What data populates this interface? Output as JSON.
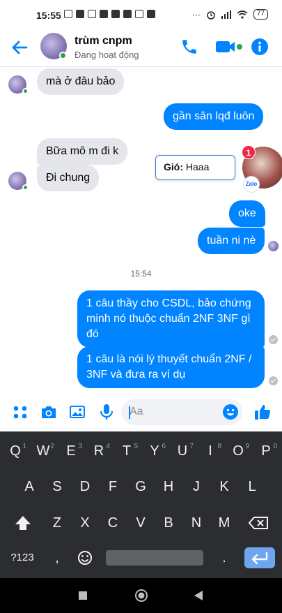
{
  "status_bar": {
    "time": "15:55",
    "battery": "77"
  },
  "header": {
    "contact_name": "trùm cnpm",
    "contact_status": "Đang hoạt động"
  },
  "messages": [
    {
      "direction": "in",
      "text": "mà ở đâu bảo"
    },
    {
      "direction": "out",
      "text": "gần sân lqđ luôn"
    },
    {
      "direction": "in",
      "text": "Bữa mô m đi k"
    },
    {
      "direction": "in",
      "text": "Đi chung"
    },
    {
      "direction": "out",
      "text": "oke"
    },
    {
      "direction": "out",
      "text": "tuần ni nè"
    },
    {
      "direction": "out",
      "lines": [
        "1 câu thầy cho CSDL, bảo chứng",
        "minh nó thuộc chuẩn 2NF 3NF gì",
        "đó"
      ]
    },
    {
      "direction": "out",
      "lines": [
        "1 câu là nói lý thuyết chuẩn 2NF /",
        "3NF và đưa ra ví dụ"
      ]
    }
  ],
  "timestamp": "15:54",
  "zalo_chathead": {
    "sender": "Gió:",
    "preview": "Haaa",
    "badge_count": "1",
    "logo_text": "Zalo"
  },
  "composer": {
    "placeholder": "Aa"
  },
  "keyboard": {
    "row1": [
      {
        "key": "Q",
        "hint": "1"
      },
      {
        "key": "W",
        "hint": "2"
      },
      {
        "key": "E",
        "hint": "3"
      },
      {
        "key": "R",
        "hint": "4"
      },
      {
        "key": "T",
        "hint": "5"
      },
      {
        "key": "Y",
        "hint": "6"
      },
      {
        "key": "U",
        "hint": "7"
      },
      {
        "key": "I",
        "hint": "8"
      },
      {
        "key": "O",
        "hint": "9"
      },
      {
        "key": "P",
        "hint": "0"
      }
    ],
    "row2": [
      "A",
      "S",
      "D",
      "F",
      "G",
      "H",
      "J",
      "K",
      "L"
    ],
    "row3": [
      "Z",
      "X",
      "C",
      "V",
      "B",
      "N",
      "M"
    ],
    "numbers_key": "?123",
    "comma_key": ",",
    "period_key": "."
  },
  "colors": {
    "messenger_blue": "#0084ff",
    "incoming_bubble": "#e4e6eb",
    "online_green": "#31a24c",
    "keyboard_bg": "#2b2d30"
  }
}
